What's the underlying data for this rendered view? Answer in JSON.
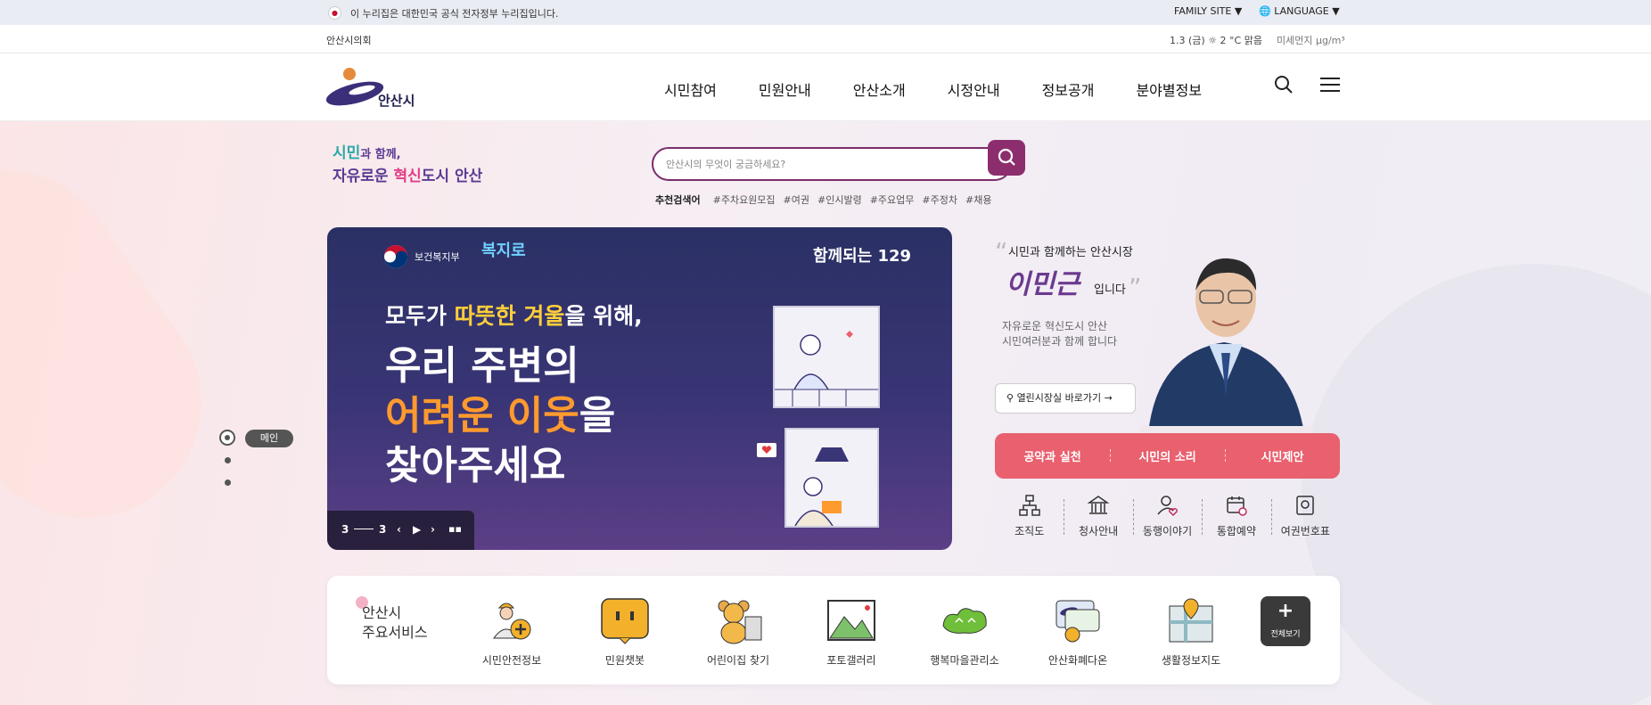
{
  "gov_banner": {
    "text": "이 누리집은 대한민국 공식 전자정부 누리집입니다.",
    "family_site": "FAMILY SITE ▼",
    "language": "🌐 LANGUAGE ▼"
  },
  "util": {
    "council": "안산시의회",
    "weather": "1.3 (금)  ☼ 2 °C 맑음",
    "dust": "미세먼지 μg/m³"
  },
  "header": {
    "logo_text": "안산시",
    "menu": [
      "시민참여",
      "민원안내",
      "안산소개",
      "시정안내",
      "정보공개",
      "분야별정보"
    ]
  },
  "hero": {
    "slogan_l1a": "시민",
    "slogan_l1b": "과 함께,",
    "slogan_l2a": "자유로운 ",
    "slogan_l2b": "혁신",
    "slogan_l2c": "도시 안산",
    "search_placeholder": "안산시의 무엇이 궁금하세요?",
    "keywords_label": "추천검색어",
    "keywords": [
      "#주차요원모집",
      "#여권",
      "#인시발령",
      "#주요업무",
      "#주정차",
      "#채용"
    ]
  },
  "banner": {
    "ministry": "보건복지부",
    "bokjiro": "복지로",
    "badge": "함께되는 129",
    "line1a": "모두가 ",
    "line1b": "따뜻한 겨울",
    "line1c": "을 위해,",
    "line2": "우리 주변의",
    "line3a": "어려운 이웃",
    "line3b": "을",
    "line4": "찾아주세요",
    "page_current": "3",
    "page_total": "3"
  },
  "side_nav": {
    "label": "메인"
  },
  "mayor": {
    "intro": "시민과 함께하는 안산시장",
    "name": "이민근",
    "name_suffix": "입니다",
    "sub1": "자유로운 혁신도시 안산",
    "sub2": "시민여러분과 함께 합니다",
    "link": "열린시장실 바로가기"
  },
  "pink_tabs": [
    "공약과 실천",
    "시민의 소리",
    "시민제안"
  ],
  "quick_links": [
    {
      "label": "조직도",
      "icon": "org-chart-icon"
    },
    {
      "label": "청사안내",
      "icon": "building-icon"
    },
    {
      "label": "동행이야기",
      "icon": "people-heart-icon"
    },
    {
      "label": "통합예약",
      "icon": "calendar-icon"
    },
    {
      "label": "여권번호표",
      "icon": "passport-icon"
    }
  ],
  "services": {
    "title_l1": "안산시",
    "title_l2": "주요서비스",
    "items": [
      {
        "label": "시민안전정보",
        "icon": "safety-worker-icon"
      },
      {
        "label": "민원챗봇",
        "icon": "chatbot-icon"
      },
      {
        "label": "어린이집 찾기",
        "icon": "teddy-bear-icon"
      },
      {
        "label": "포토갤러리",
        "icon": "photo-icon"
      },
      {
        "label": "행복마을관리소",
        "icon": "village-icon"
      },
      {
        "label": "안산화폐다온",
        "icon": "currency-icon"
      },
      {
        "label": "생활정보지도",
        "icon": "map-pin-icon"
      }
    ],
    "all_label": "전체보기"
  },
  "colors": {
    "accent": "#8c2e6e",
    "pink": "#e9606e",
    "banner_bg": "#2a3064"
  }
}
